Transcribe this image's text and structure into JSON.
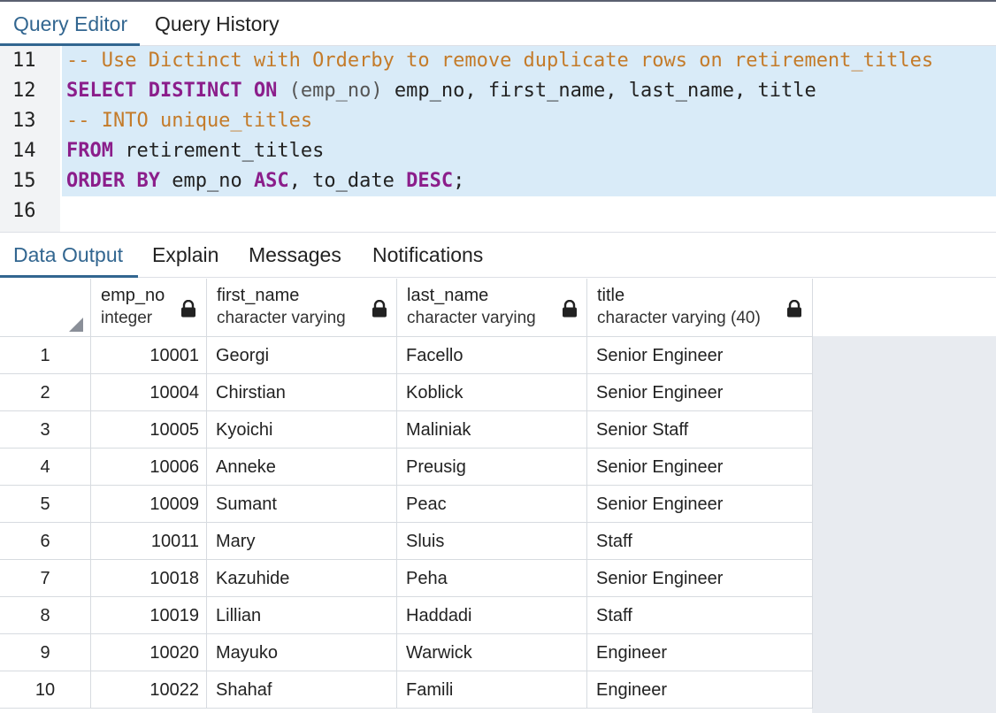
{
  "editor_tabs": [
    {
      "label": "Query Editor",
      "active": true
    },
    {
      "label": "Query History",
      "active": false
    }
  ],
  "editor": {
    "lines": [
      {
        "number": "11",
        "selected": true,
        "tokens": [
          {
            "t": "comment",
            "v": "-- Use Dictinct with Orderby to remove duplicate rows on retirement_titles"
          }
        ]
      },
      {
        "number": "12",
        "selected": true,
        "tokens": [
          {
            "t": "kw",
            "v": "SELECT DISTINCT ON"
          },
          {
            "t": "plain",
            "v": " "
          },
          {
            "t": "paren",
            "v": "(emp_no)"
          },
          {
            "t": "plain",
            "v": " emp_no, first_name, last_name, title"
          }
        ]
      },
      {
        "number": "13",
        "selected": true,
        "tokens": [
          {
            "t": "comment",
            "v": "-- INTO unique_titles"
          }
        ]
      },
      {
        "number": "14",
        "selected": true,
        "tokens": [
          {
            "t": "kw",
            "v": "FROM"
          },
          {
            "t": "plain",
            "v": " retirement_titles"
          }
        ]
      },
      {
        "number": "15",
        "selected": true,
        "tokens": [
          {
            "t": "kw",
            "v": "ORDER BY"
          },
          {
            "t": "plain",
            "v": " emp_no "
          },
          {
            "t": "kw",
            "v": "ASC"
          },
          {
            "t": "plain",
            "v": ", to_date "
          },
          {
            "t": "kw",
            "v": "DESC"
          },
          {
            "t": "plain",
            "v": ";"
          }
        ]
      },
      {
        "number": "16",
        "selected": false,
        "tokens": []
      }
    ]
  },
  "output_tabs": [
    {
      "label": "Data Output",
      "active": true
    },
    {
      "label": "Explain",
      "active": false
    },
    {
      "label": "Messages",
      "active": false
    },
    {
      "label": "Notifications",
      "active": false
    }
  ],
  "table": {
    "columns": [
      {
        "name": "emp_no",
        "type": "integer",
        "icon": "lock-icon"
      },
      {
        "name": "first_name",
        "type": "character varying",
        "icon": "lock-icon"
      },
      {
        "name": "last_name",
        "type": "character varying",
        "icon": "lock-icon"
      },
      {
        "name": "title",
        "type": "character varying (40)",
        "icon": "lock-icon"
      }
    ],
    "rows": [
      [
        "1",
        "10001",
        "Georgi",
        "Facello",
        "Senior Engineer"
      ],
      [
        "2",
        "10004",
        "Chirstian",
        "Koblick",
        "Senior Engineer"
      ],
      [
        "3",
        "10005",
        "Kyoichi",
        "Maliniak",
        "Senior Staff"
      ],
      [
        "4",
        "10006",
        "Anneke",
        "Preusig",
        "Senior Engineer"
      ],
      [
        "5",
        "10009",
        "Sumant",
        "Peac",
        "Senior Engineer"
      ],
      [
        "6",
        "10011",
        "Mary",
        "Sluis",
        "Staff"
      ],
      [
        "7",
        "10018",
        "Kazuhide",
        "Peha",
        "Senior Engineer"
      ],
      [
        "8",
        "10019",
        "Lillian",
        "Haddadi",
        "Staff"
      ],
      [
        "9",
        "10020",
        "Mayuko",
        "Warwick",
        "Engineer"
      ],
      [
        "10",
        "10022",
        "Shahaf",
        "Famili",
        "Engineer"
      ]
    ]
  },
  "colors": {
    "accent": "#326690",
    "selection": "#d9ebf8",
    "keyword": "#8b1e8b",
    "comment": "#c47b2a"
  }
}
